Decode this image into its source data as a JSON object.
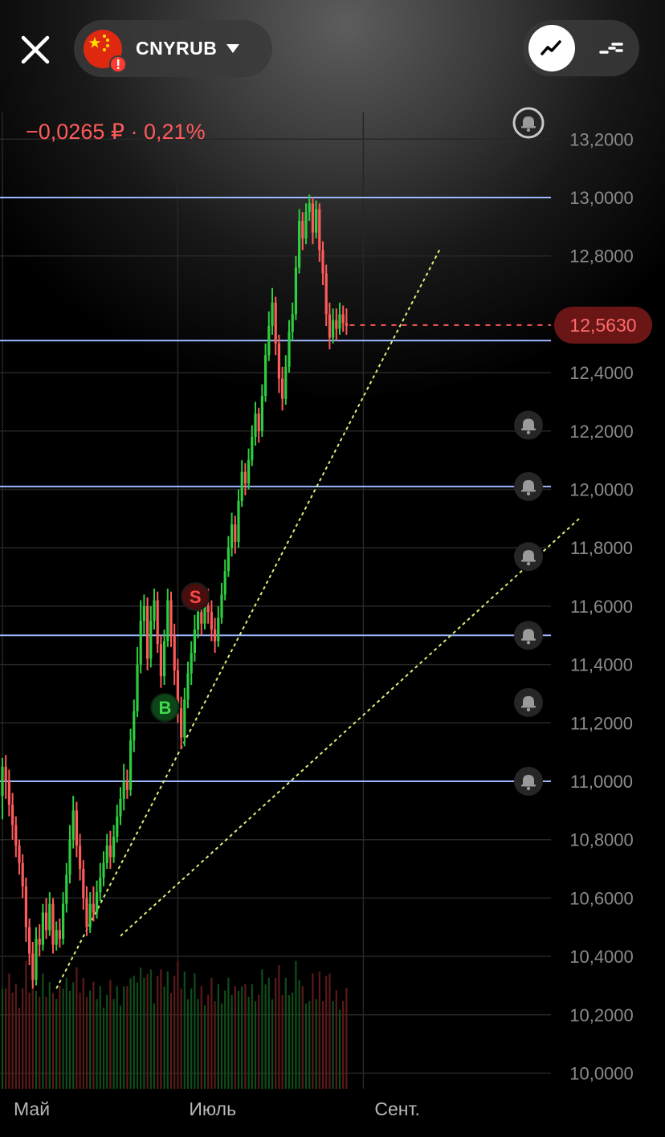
{
  "header": {
    "ticker": "CNYRUB",
    "change_text": "−0,0265 ₽ · 0,21%"
  },
  "icons": {
    "close": "close-icon",
    "flag": "china-flag-icon",
    "warning": "warning-badge-icon",
    "dropdown": "chevron-down-icon",
    "line_mode": "line-chart-icon",
    "candle_mode": "candlestick-chart-icon",
    "alert": "bell-icon"
  },
  "colors": {
    "up": "#2ecc40",
    "down": "#ff5a5a",
    "level_line": "#9db8ff",
    "trend_line": "#d8f07a",
    "price_badge": "#6b1616"
  },
  "chart_data": {
    "type": "candlestick",
    "ylim": [
      10.0,
      13.3
    ],
    "y_ticks": [
      "13,2000",
      "13,0000",
      "12,8000",
      "12,4000",
      "12,2000",
      "12,0000",
      "11,8000",
      "11,6000",
      "11,4000",
      "11,2000",
      "11,0000",
      "10,8000",
      "10,6000",
      "10,4000",
      "10,2000",
      "10,0000"
    ],
    "y_tick_values": [
      13.2,
      13.0,
      12.8,
      12.4,
      12.2,
      12.0,
      11.8,
      11.6,
      11.4,
      11.2,
      11.0,
      10.8,
      10.6,
      10.4,
      10.2,
      10.0
    ],
    "x_labels": [
      "Май",
      "Июль",
      "Сент."
    ],
    "x_label_index": [
      0,
      52,
      107
    ],
    "current_price": 12.563,
    "current_price_label": "12,5630",
    "level_lines": [
      13.0,
      12.51,
      12.01,
      11.5,
      11.0
    ],
    "alert_levels": [
      13.2,
      12.22,
      12.01,
      11.77,
      11.5,
      11.27,
      11.0
    ],
    "trend_lines": [
      {
        "from": [
          16,
          10.29
        ],
        "to": [
          130,
          12.83
        ]
      },
      {
        "from": [
          35,
          10.47
        ],
        "to": [
          171,
          11.9
        ]
      }
    ],
    "markers": [
      {
        "label": "S",
        "index": 56,
        "value": 11.63,
        "kind": "sell"
      },
      {
        "label": "B",
        "index": 47,
        "value": 11.23,
        "kind": "buy"
      }
    ],
    "candles": [
      [
        10.95,
        11.05,
        10.87,
        11.08
      ],
      [
        11.05,
        11.0,
        10.94,
        11.09
      ],
      [
        11.0,
        10.92,
        10.88,
        11.04
      ],
      [
        10.92,
        10.85,
        10.8,
        10.96
      ],
      [
        10.85,
        10.78,
        10.74,
        10.88
      ],
      [
        10.78,
        10.72,
        10.68,
        10.8
      ],
      [
        10.72,
        10.64,
        10.6,
        10.75
      ],
      [
        10.64,
        10.5,
        10.45,
        10.67
      ],
      [
        10.5,
        10.41,
        10.37,
        10.53
      ],
      [
        10.41,
        10.32,
        10.29,
        10.45
      ],
      [
        10.32,
        10.46,
        10.3,
        10.5
      ],
      [
        10.46,
        10.44,
        10.4,
        10.51
      ],
      [
        10.44,
        10.55,
        10.42,
        10.58
      ],
      [
        10.55,
        10.49,
        10.46,
        10.6
      ],
      [
        10.49,
        10.58,
        10.47,
        10.62
      ],
      [
        10.58,
        10.44,
        10.41,
        10.6
      ],
      [
        10.44,
        10.49,
        10.42,
        10.52
      ],
      [
        10.49,
        10.46,
        10.43,
        10.53
      ],
      [
        10.46,
        10.58,
        10.44,
        10.62
      ],
      [
        10.58,
        10.68,
        10.55,
        10.72
      ],
      [
        10.68,
        10.8,
        10.65,
        10.85
      ],
      [
        10.8,
        10.9,
        10.77,
        10.95
      ],
      [
        10.9,
        10.78,
        10.74,
        10.93
      ],
      [
        10.78,
        10.7,
        10.66,
        10.82
      ],
      [
        10.7,
        10.6,
        10.56,
        10.73
      ],
      [
        10.6,
        10.5,
        10.47,
        10.64
      ],
      [
        10.5,
        10.58,
        10.48,
        10.62
      ],
      [
        10.58,
        10.55,
        10.52,
        10.64
      ],
      [
        10.55,
        10.62,
        10.53,
        10.66
      ],
      [
        10.62,
        10.67,
        10.59,
        10.72
      ],
      [
        10.67,
        10.72,
        10.64,
        10.76
      ],
      [
        10.72,
        10.78,
        10.7,
        10.82
      ],
      [
        10.78,
        10.74,
        10.7,
        10.83
      ],
      [
        10.74,
        10.81,
        10.72,
        10.85
      ],
      [
        10.81,
        10.88,
        10.79,
        10.92
      ],
      [
        10.88,
        10.94,
        10.85,
        10.98
      ],
      [
        10.94,
        11.0,
        10.9,
        11.06
      ],
      [
        11.0,
        10.97,
        10.94,
        11.04
      ],
      [
        10.97,
        11.14,
        10.95,
        11.18
      ],
      [
        11.14,
        11.24,
        11.1,
        11.28
      ],
      [
        11.24,
        11.4,
        11.22,
        11.46
      ],
      [
        11.4,
        11.55,
        11.37,
        11.62
      ],
      [
        11.55,
        11.6,
        11.5,
        11.64
      ],
      [
        11.6,
        11.42,
        11.38,
        11.63
      ],
      [
        11.42,
        11.55,
        11.39,
        11.6
      ],
      [
        11.55,
        11.62,
        11.52,
        11.66
      ],
      [
        11.62,
        11.47,
        11.44,
        11.65
      ],
      [
        11.47,
        11.36,
        11.32,
        11.5
      ],
      [
        11.36,
        11.48,
        11.33,
        11.52
      ],
      [
        11.48,
        11.62,
        11.46,
        11.66
      ],
      [
        11.62,
        11.5,
        11.46,
        11.65
      ],
      [
        11.5,
        11.38,
        11.33,
        11.54
      ],
      [
        11.38,
        11.25,
        11.2,
        11.42
      ],
      [
        11.25,
        11.15,
        11.11,
        11.29
      ],
      [
        11.15,
        11.28,
        11.12,
        11.32
      ],
      [
        11.28,
        11.37,
        11.25,
        11.41
      ],
      [
        11.37,
        11.44,
        11.33,
        11.48
      ],
      [
        11.44,
        11.52,
        11.41,
        11.57
      ],
      [
        11.52,
        11.58,
        11.49,
        11.62
      ],
      [
        11.58,
        11.54,
        11.5,
        11.63
      ],
      [
        11.54,
        11.6,
        11.52,
        11.65
      ],
      [
        11.6,
        11.58,
        11.54,
        11.66
      ],
      [
        11.58,
        11.52,
        11.48,
        11.62
      ],
      [
        11.52,
        11.48,
        11.44,
        11.56
      ],
      [
        11.48,
        11.56,
        11.46,
        11.6
      ],
      [
        11.56,
        11.64,
        11.54,
        11.68
      ],
      [
        11.64,
        11.72,
        11.62,
        11.76
      ],
      [
        11.72,
        11.8,
        11.7,
        11.84
      ],
      [
        11.8,
        11.88,
        11.77,
        11.92
      ],
      [
        11.88,
        11.82,
        11.78,
        11.91
      ],
      [
        11.82,
        11.96,
        11.8,
        12.0
      ],
      [
        11.96,
        12.06,
        11.94,
        12.1
      ],
      [
        12.06,
        12.02,
        11.98,
        12.09
      ],
      [
        12.02,
        12.1,
        12.0,
        12.14
      ],
      [
        12.1,
        12.18,
        12.08,
        12.22
      ],
      [
        12.18,
        12.26,
        12.15,
        12.3
      ],
      [
        12.26,
        12.2,
        12.16,
        12.28
      ],
      [
        12.2,
        12.32,
        12.18,
        12.36
      ],
      [
        12.32,
        12.46,
        12.3,
        12.5
      ],
      [
        12.46,
        12.56,
        12.44,
        12.61
      ],
      [
        12.56,
        12.64,
        12.53,
        12.69
      ],
      [
        12.64,
        12.5,
        12.46,
        12.66
      ],
      [
        12.5,
        12.38,
        12.33,
        12.53
      ],
      [
        12.38,
        12.31,
        12.27,
        12.42
      ],
      [
        12.31,
        12.42,
        12.29,
        12.46
      ],
      [
        12.42,
        12.54,
        12.4,
        12.58
      ],
      [
        12.54,
        12.6,
        12.51,
        12.64
      ],
      [
        12.6,
        12.76,
        12.58,
        12.8
      ],
      [
        12.76,
        12.92,
        12.74,
        12.96
      ],
      [
        12.92,
        12.86,
        12.82,
        12.95
      ],
      [
        12.86,
        12.95,
        12.84,
        12.98
      ],
      [
        12.95,
        12.98,
        12.92,
        13.01
      ],
      [
        12.98,
        12.88,
        12.84,
        13.0
      ],
      [
        12.88,
        12.96,
        12.86,
        12.99
      ],
      [
        12.96,
        12.82,
        12.78,
        12.98
      ],
      [
        12.82,
        12.74,
        12.7,
        12.85
      ],
      [
        12.74,
        12.6,
        12.56,
        12.77
      ],
      [
        12.6,
        12.52,
        12.48,
        12.64
      ],
      [
        12.52,
        12.58,
        12.5,
        12.62
      ],
      [
        12.58,
        12.55,
        12.51,
        12.62
      ],
      [
        12.55,
        12.6,
        12.53,
        12.64
      ],
      [
        12.6,
        12.57,
        12.54,
        12.63
      ],
      [
        12.57,
        12.56,
        12.53,
        12.62
      ]
    ]
  }
}
